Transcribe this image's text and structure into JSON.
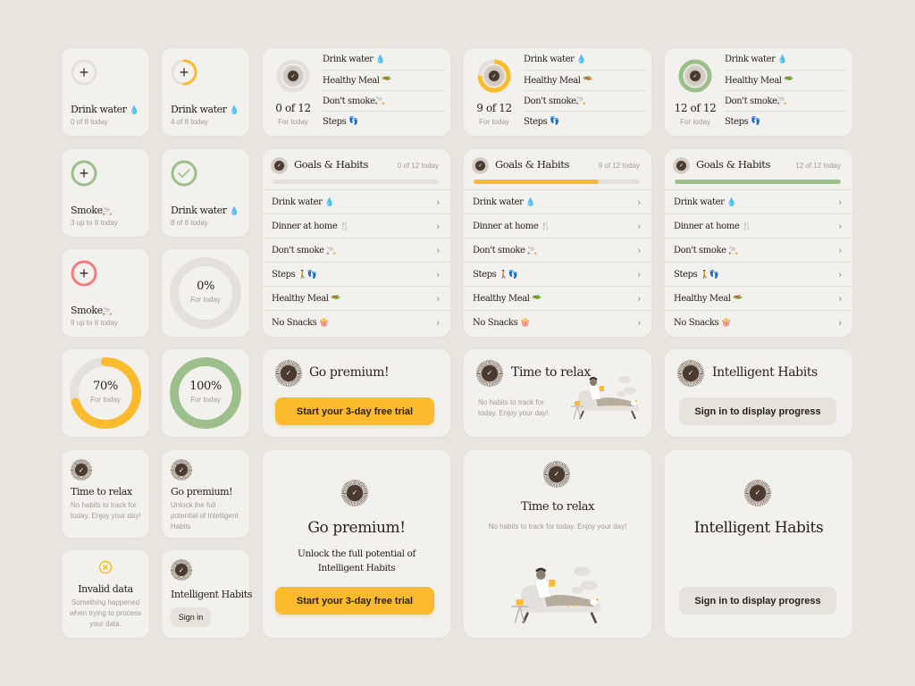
{
  "colors": {
    "background": "#e8e5df",
    "card": "#f2f1ee",
    "accent_yellow": "#fbbb2c",
    "accent_green": "#9cbf8c",
    "accent_red": "#f27d7d",
    "ring_track": "#e4e1dc",
    "dark": "#4a3a30"
  },
  "small_tiles": [
    {
      "title": "Drink water",
      "emoji": "💧",
      "sub": "0 of 8 today",
      "icon": "plus-icon",
      "progress": 0,
      "ring_color": "#e4e1dc"
    },
    {
      "title": "Drink water",
      "emoji": "💧",
      "sub": "4 of 8 today",
      "icon": "plus-icon",
      "progress": 0.5,
      "ring_color": "#fbbb2c"
    },
    {
      "title": "Smoke",
      "emoji": "🚬",
      "sub": "3 up to 8 today",
      "icon": "plus-icon",
      "progress": 1,
      "ring_color": "#9cbf8c"
    },
    {
      "title": "Drink water",
      "emoji": "💧",
      "sub": "8 of 8 today",
      "icon": "check-icon",
      "progress": 1,
      "ring_color": "#9cbf8c"
    },
    {
      "title": "Smoke",
      "emoji": "🚬",
      "sub": "9 up to 8 today",
      "icon": "plus-icon",
      "progress": 1,
      "ring_color": "#f27d7d"
    }
  ],
  "percent_tiles": [
    {
      "value": "0%",
      "label": "For today",
      "progress": 0,
      "color": "#e4e1dc"
    },
    {
      "value": "70%",
      "label": "For today",
      "progress": 0.7,
      "color": "#fbbb2c"
    },
    {
      "value": "100%",
      "label": "For today",
      "progress": 1,
      "color": "#9cbf8c"
    }
  ],
  "summary_cards": [
    {
      "count": "0 of 12",
      "label": "For today",
      "progress": 0,
      "color": "#e4e1dc",
      "items": [
        {
          "name": "Drink water",
          "emoji": "💧"
        },
        {
          "name": "Healthy Meal",
          "emoji": "🥗"
        },
        {
          "name": "Don't smoke",
          "emoji": "🚬"
        },
        {
          "name": "Steps",
          "emoji": "👣"
        }
      ]
    },
    {
      "count": "9 of 12",
      "label": "For today",
      "progress": 0.75,
      "color": "#fbbb2c",
      "items": [
        {
          "name": "Drink water",
          "emoji": "💧"
        },
        {
          "name": "Healthy Meal",
          "emoji": "🥗"
        },
        {
          "name": "Don't smoke",
          "emoji": "🚬"
        },
        {
          "name": "Steps",
          "emoji": "👣"
        }
      ]
    },
    {
      "count": "12 of 12",
      "label": "For today",
      "progress": 1,
      "color": "#9cbf8c",
      "items": [
        {
          "name": "Drink water",
          "emoji": "💧"
        },
        {
          "name": "Healthy Meal",
          "emoji": "🥗"
        },
        {
          "name": "Don't smoke",
          "emoji": "🚬"
        },
        {
          "name": "Steps",
          "emoji": "👣"
        }
      ]
    }
  ],
  "goals_cards": [
    {
      "title": "Goals & Habits",
      "count": "0 of 12 today",
      "progress": 0,
      "color": "#fbbb2c"
    },
    {
      "title": "Goals & Habits",
      "count": "9 of 12 today",
      "progress": 0.75,
      "color": "#fbbb2c"
    },
    {
      "title": "Goals & Habits",
      "count": "12 of 12 today",
      "progress": 1,
      "color": "#9cbf8c"
    }
  ],
  "goals_items": [
    {
      "name": "Drink water",
      "emoji": "💧"
    },
    {
      "name": "Dinner at home",
      "emoji": "🍴"
    },
    {
      "name": "Don't smoke",
      "emoji": "🚬"
    },
    {
      "name": "Steps",
      "emoji": "🚶👣"
    },
    {
      "name": "Healthy Meal",
      "emoji": "🥗"
    },
    {
      "name": "No Snacks",
      "emoji": "🍿"
    }
  ],
  "premium_wide": {
    "title": "Go premium!",
    "button": "Start your 3-day free trial"
  },
  "relax_wide": {
    "title": "Time to relax",
    "text": "No habits to track for today. Enjoy your day!"
  },
  "intelligent_wide": {
    "title": "Intelligent Habits",
    "button": "Sign in to display progress"
  },
  "relax_small": {
    "title": "Time to relax",
    "text": "No habits to track for today. Enjoy your day!"
  },
  "premium_small": {
    "title": "Go premium!",
    "text": "Unlock the full potential of Intelligent Habits"
  },
  "invalid_small": {
    "title": "Invalid data",
    "text": "Something happened when trying to process your data."
  },
  "intelligent_small": {
    "title": "Intelligent Habits",
    "button": "Sign in"
  },
  "premium_large": {
    "title": "Go premium!",
    "text": "Unlock the full potential of Intelligent Habits",
    "button": "Start your 3-day free trial"
  },
  "relax_large": {
    "title": "Time to relax",
    "text": "No habits to track for today. Enjoy your day!"
  },
  "intelligent_large": {
    "title": "Intelligent Habits",
    "button": "Sign in to display progress"
  }
}
